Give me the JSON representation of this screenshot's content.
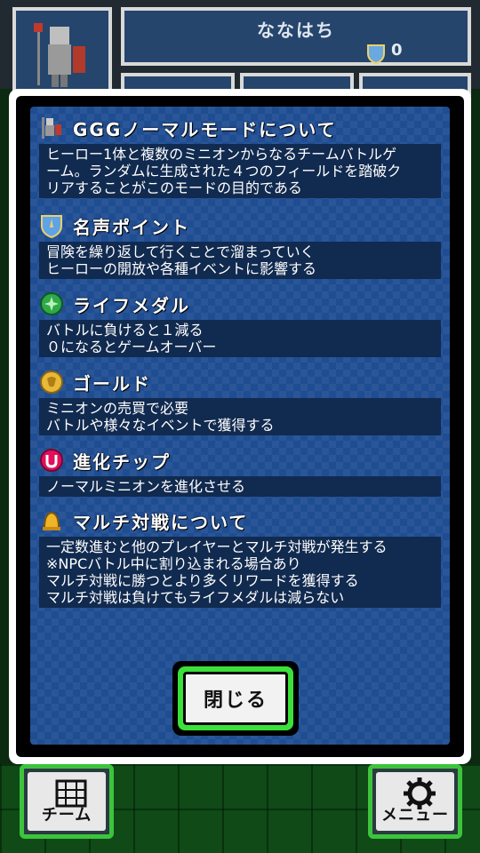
{
  "header": {
    "player_name": "ななはち",
    "fame_points": "0"
  },
  "modal": {
    "sections": [
      {
        "icon": "hero-knight-icon",
        "title": "GGGノーマルモードについて",
        "lines": [
          "ヒーロー1体と複数のミニオンからなるチームバトルゲ",
          "ーム。ランダムに生成された４つのフィールドを踏破ク",
          "リアすることがこのモードの目的である"
        ]
      },
      {
        "icon": "fame-shield-icon",
        "title": "名声ポイント",
        "lines": [
          "冒険を繰り返して行くことで溜まっていく",
          "ヒーローの開放や各種イベントに影響する"
        ]
      },
      {
        "icon": "life-medal-icon",
        "title": "ライフメダル",
        "lines": [
          "バトルに負けると１減る",
          "０になるとゲームオーバー"
        ]
      },
      {
        "icon": "gold-coin-icon",
        "title": "ゴールド",
        "lines": [
          "ミニオンの売買で必要",
          "バトルや様々なイベントで獲得する"
        ]
      },
      {
        "icon": "evolution-chip-icon",
        "title": "進化チップ",
        "lines": [
          "ノーマルミニオンを進化させる"
        ]
      },
      {
        "icon": "multi-battle-bell-icon",
        "title": "マルチ対戦について",
        "lines": [
          "一定数進むと他のプレイヤーとマルチ対戦が発生する",
          "※NPCバトル中に割り込まれる場合あり",
          "マルチ対戦に勝つとより多くリワードを獲得する",
          "マルチ対戦は負けてもライフメダルは減らない"
        ]
      }
    ],
    "close_label": "閉じる"
  },
  "bottom_nav": {
    "team_label": "チーム",
    "menu_label": "メニュー"
  },
  "colors": {
    "panel_blue": "#1f4d92",
    "text_box": "#112a4f",
    "button_green": "#3be03b"
  }
}
